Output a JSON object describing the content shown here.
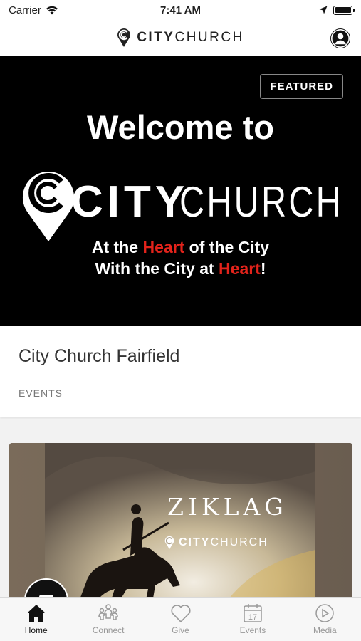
{
  "status": {
    "carrier": "Carrier",
    "time": "7:41 AM",
    "battery_level": 1.0
  },
  "header": {
    "logo_bold": "CITY",
    "logo_light": "CHURCH",
    "profile_icon": "user-circle-icon"
  },
  "hero": {
    "badge": "FEATURED",
    "welcome": "Welcome to",
    "logo_bold": "CITY",
    "logo_light": "CHURCH",
    "tagline_line1_a": "At the ",
    "tagline_line1_b": "Heart",
    "tagline_line1_c": " of the City",
    "tagline_line2_a": "With the City at ",
    "tagline_line2_b": "Heart",
    "tagline_line2_c": "!"
  },
  "info": {
    "title": "City Church Fairfield",
    "category": "EVENTS"
  },
  "event": {
    "title": "ZIKLAG",
    "sub_bold": "CITY",
    "sub_light": "CHURCH"
  },
  "tabs": [
    {
      "label": "Home",
      "icon": "home-icon",
      "active": true
    },
    {
      "label": "Connect",
      "icon": "people-icon",
      "active": false
    },
    {
      "label": "Give",
      "icon": "heart-icon",
      "active": false
    },
    {
      "label": "Events",
      "icon": "calendar-icon",
      "active": false,
      "day": "17"
    },
    {
      "label": "Media",
      "icon": "play-icon",
      "active": false
    }
  ],
  "colors": {
    "accent_red": "#e3231b",
    "hero_bg": "#000000",
    "tab_active": "#111111",
    "tab_inactive": "#999999"
  }
}
